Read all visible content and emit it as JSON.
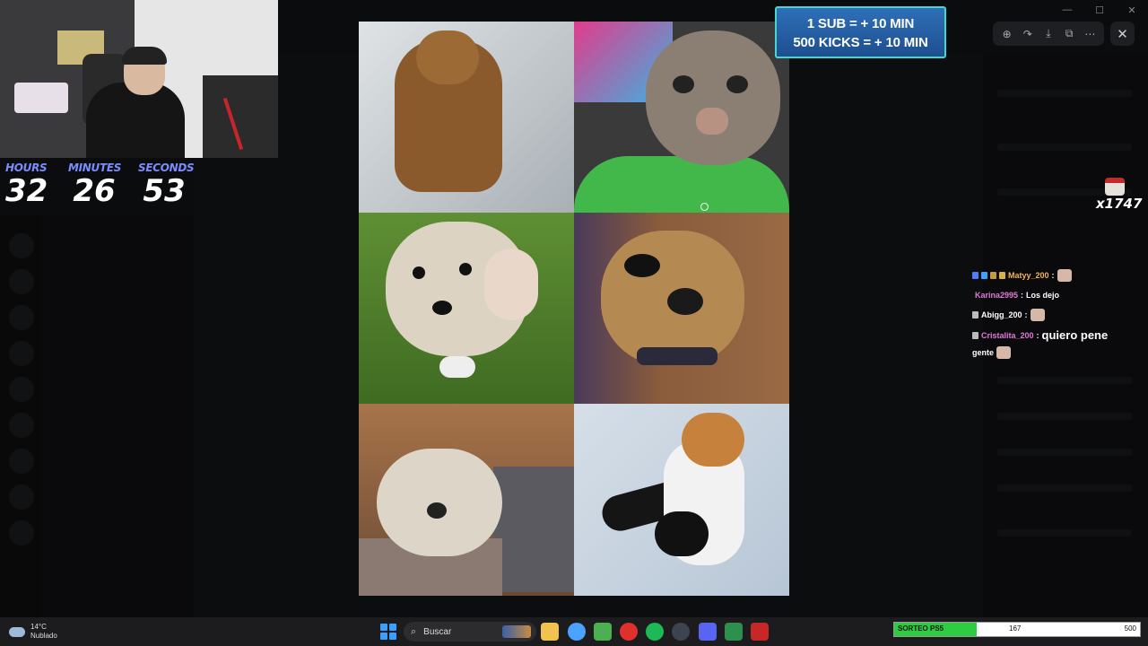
{
  "timer": {
    "hours_label": "HOURS",
    "hours": "32",
    "minutes_label": "MINUTES",
    "minutes": "26",
    "seconds_label": "SECONDS",
    "seconds": "53"
  },
  "banner": {
    "line1": "1 SUB = + 10 MIN",
    "line2": "500 KICKS = + 10 MIN"
  },
  "viewer_toolbar": {
    "icons": [
      "zoom-icon",
      "forward-icon",
      "download-icon",
      "open-external-icon",
      "more-icon"
    ],
    "close_glyph": "✕"
  },
  "combo": {
    "count": "x1747"
  },
  "chat": [
    {
      "name": "Matyy_200",
      "name_color": "#f0b45a",
      "message": "",
      "emote": true,
      "badges": [
        "#4f7cff",
        "#3aa3ff",
        "#c79a3a",
        "#d8b04a"
      ]
    },
    {
      "name": "Karina2995",
      "name_color": "#e07ad6",
      "message": "Los dejo",
      "emote": false,
      "badges": []
    },
    {
      "name": "Abigg_200",
      "name_color": "#ffffff",
      "message": "",
      "emote": true,
      "badges": [
        "#bbbbbb"
      ]
    },
    {
      "name": "Cristalita_200",
      "name_color": "#e07ad6",
      "message": "quiero pene",
      "emote": false,
      "badges": [
        "#bbbbbb"
      ]
    },
    {
      "name": "",
      "name_color": "#ffffff",
      "message": "gente",
      "emote": true,
      "badges": []
    }
  ],
  "taskbar": {
    "weather_temp": "14°C",
    "weather_desc": "Nublado",
    "search_placeholder": "Buscar",
    "sorteo_label": "SORTEO PS5",
    "sorteo_value": "167",
    "sorteo_max": "500",
    "sorteo_fraction": 0.334,
    "apps": [
      {
        "name": "file-explorer-icon",
        "color": "#f2c14e"
      },
      {
        "name": "chrome-icon",
        "color": "#4aa3ff"
      },
      {
        "name": "minecraft-icon",
        "color": "#4caf50"
      },
      {
        "name": "opera-icon",
        "color": "#e0302c"
      },
      {
        "name": "spotify-icon",
        "color": "#1db954"
      },
      {
        "name": "steam-icon",
        "color": "#3d4450"
      },
      {
        "name": "discord-icon",
        "color": "#5865f2"
      },
      {
        "name": "app-green-icon",
        "color": "#2f8f4f"
      },
      {
        "name": "app-stream-icon",
        "color": "#c62828"
      }
    ]
  }
}
